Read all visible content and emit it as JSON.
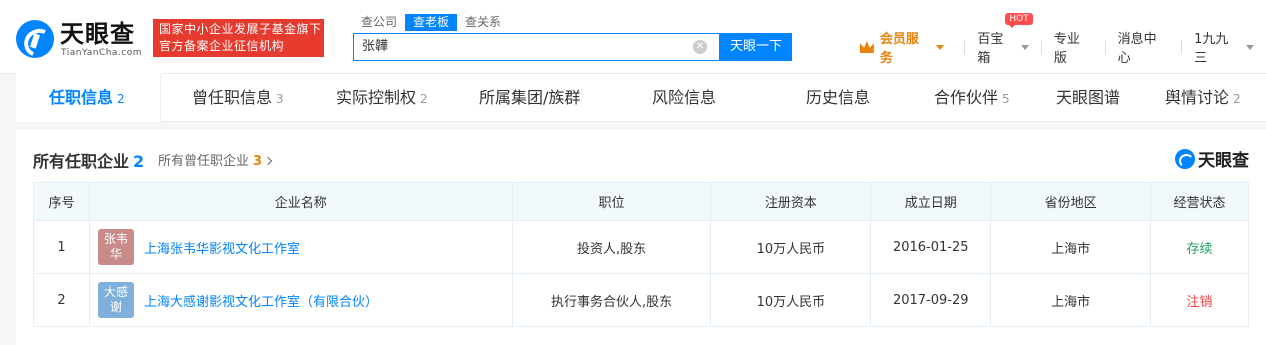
{
  "header": {
    "logo_text": "天眼查",
    "logo_sub": "TianYanCha.com",
    "banner_line1": "国家中小企业发展子基金旗下",
    "banner_line2": "官方备案企业征信机构",
    "search_tabs": [
      "查公司",
      "查老板",
      "查关系"
    ],
    "search_value": "张韡",
    "search_button": "天眼一下",
    "vip": "会员服务",
    "nav": {
      "baobaoxiang": "百宝箱",
      "hot": "HOT",
      "pro": "专业版",
      "messages": "消息中心",
      "user": "1九九三"
    }
  },
  "tabs": [
    {
      "label": "任职信息",
      "count": "2"
    },
    {
      "label": "曾任职信息",
      "count": "3"
    },
    {
      "label": "实际控制权",
      "count": "2"
    },
    {
      "label": "所属集团/族群",
      "count": ""
    },
    {
      "label": "风险信息",
      "count": ""
    },
    {
      "label": "历史信息",
      "count": ""
    },
    {
      "label": "合作伙伴",
      "count": "5"
    },
    {
      "label": "天眼图谱",
      "count": ""
    },
    {
      "label": "舆情讨论",
      "count": "2"
    }
  ],
  "section": {
    "title": "所有任职企业",
    "count": "2",
    "former_label": "所有曾任职企业",
    "former_count": "3",
    "brand": "天眼查"
  },
  "table": {
    "headers": [
      "序号",
      "企业名称",
      "职位",
      "注册资本",
      "成立日期",
      "省份地区",
      "经营状态"
    ],
    "rows": [
      {
        "index": "1",
        "avatar": "张韦华",
        "avatar_color": "#c98a8a",
        "name": "上海张韦华影视文化工作室",
        "position": "投资人,股东",
        "capital": "10万人民币",
        "date": "2016-01-25",
        "region": "上海市",
        "status": "存续",
        "status_color": "#20a162"
      },
      {
        "index": "2",
        "avatar": "大感谢",
        "avatar_color": "#7fb0dc",
        "name": "上海大感谢影视文化工作室（有限合伙）",
        "position": "执行事务合伙人,股东",
        "capital": "10万人民币",
        "date": "2017-09-29",
        "region": "上海市",
        "status": "注销",
        "status_color": "#f04142"
      }
    ]
  }
}
